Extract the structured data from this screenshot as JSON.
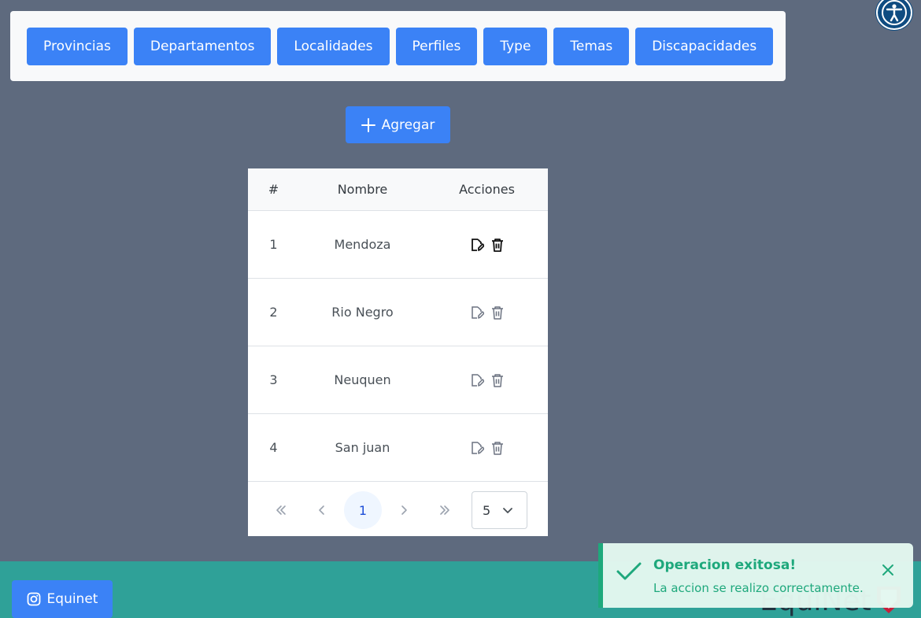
{
  "nav": {
    "items": [
      {
        "label": "Provincias"
      },
      {
        "label": "Departamentos"
      },
      {
        "label": "Localidades"
      },
      {
        "label": "Perfiles"
      },
      {
        "label": "Type"
      },
      {
        "label": "Temas"
      },
      {
        "label": "Discapacidades"
      }
    ]
  },
  "accessibility": {
    "icon": "accessibility-icon"
  },
  "toolbar": {
    "add_label": "Agregar",
    "add_icon": "plus-icon"
  },
  "table": {
    "headers": {
      "num": "#",
      "name": "Nombre",
      "actions": "Acciones"
    },
    "rows": [
      {
        "num": "1",
        "name": "Mendoza"
      },
      {
        "num": "2",
        "name": "Rio Negro"
      },
      {
        "num": "3",
        "name": "Neuquen"
      },
      {
        "num": "4",
        "name": "San juan"
      }
    ],
    "action_icons": [
      "edit-icon",
      "trash-icon"
    ]
  },
  "paginator": {
    "current_page": "1",
    "rows_per_page": "5"
  },
  "footer": {
    "instagram_label": "Equinet",
    "brand": "EquiNet"
  },
  "toast": {
    "title": "Operacion exitosa!",
    "detail": "La accion se realizo correctamente.",
    "color": "#1ea97c"
  },
  "colors": {
    "primary": "#3b82f6",
    "background": "#5e6a7e",
    "footer": "#2fa198"
  }
}
